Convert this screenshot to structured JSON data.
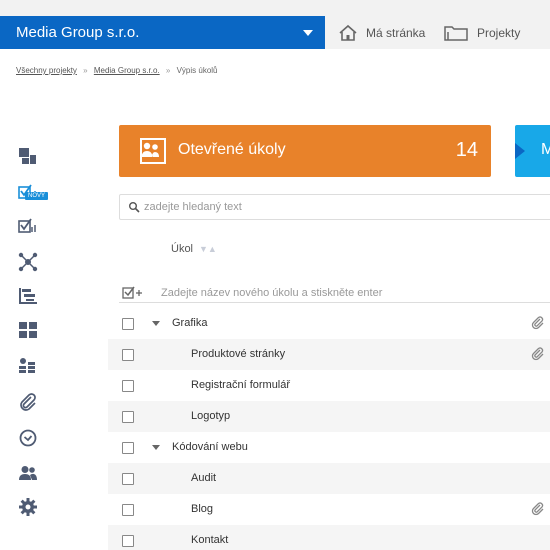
{
  "topbar": {
    "company": "Media Group s.r.o.",
    "home_label": "Má stránka",
    "projects_label": "Projekty"
  },
  "breadcrumb": {
    "all_projects": "Všechny projekty",
    "project": "Media Group s.r.o.",
    "current": "Výpis úkolů",
    "separator": "»"
  },
  "sidebar": {
    "new_badge": "NOVÝ",
    "items": [
      {
        "icon": "dashboard-icon"
      },
      {
        "icon": "tasks-new-icon"
      },
      {
        "icon": "tasks-icon"
      },
      {
        "icon": "network-icon"
      },
      {
        "icon": "gantt-icon"
      },
      {
        "icon": "tiles-icon"
      },
      {
        "icon": "coins-icon"
      },
      {
        "icon": "paperclip-icon"
      },
      {
        "icon": "clock-icon"
      },
      {
        "icon": "users-icon"
      },
      {
        "icon": "gear-icon"
      }
    ]
  },
  "cards": {
    "open_tasks_title": "Otevřené úkoly",
    "open_tasks_count": "14",
    "second_card_partial": "M"
  },
  "search": {
    "placeholder": "zadejte hledaný text"
  },
  "table": {
    "column_task": "Úkol",
    "sort_glyph": "▼▲"
  },
  "newtask": {
    "placeholder": "Zadejte název nového úkolu a stiskněte enter"
  },
  "rows": [
    {
      "label": "Grafika",
      "group": true,
      "attachment": true
    },
    {
      "label": "Produktové stránky",
      "group": false,
      "attachment": true
    },
    {
      "label": "Registrační formulář",
      "group": false,
      "attachment": false
    },
    {
      "label": "Logotyp",
      "group": false,
      "attachment": false
    },
    {
      "label": "Kódování webu",
      "group": true,
      "attachment": false
    },
    {
      "label": "Audit",
      "group": false,
      "attachment": false
    },
    {
      "label": "Blog",
      "group": false,
      "attachment": true
    },
    {
      "label": "Kontakt",
      "group": false,
      "attachment": false
    }
  ],
  "colors": {
    "brand_blue": "#0a67c4",
    "accent_orange": "#e8822a",
    "accent_cyan": "#18a8e8",
    "sidebar_icon": "#4f5b73"
  }
}
